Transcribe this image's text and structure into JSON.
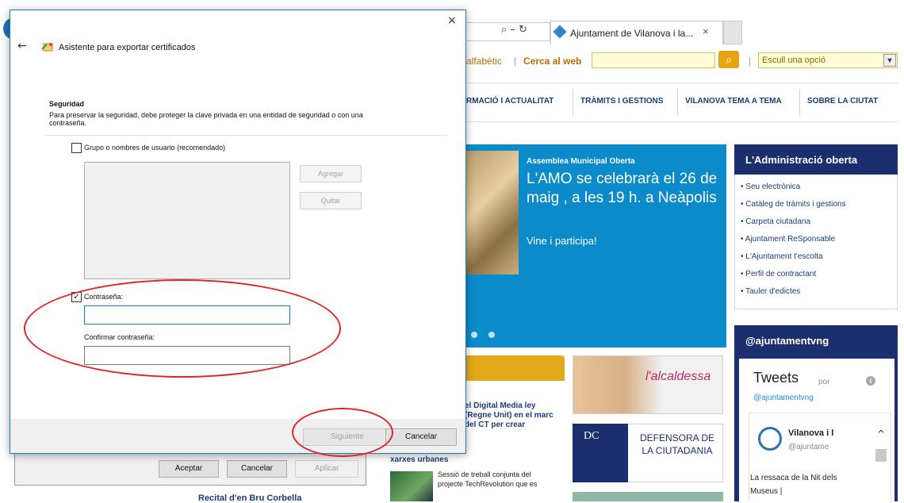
{
  "browser": {
    "tab_title": "Ajuntament de Vilanova i la...",
    "address_icons": "⌕ – ↻",
    "tab_close": "×",
    "toolbar": {
      "alfabetic": "alfabètic",
      "sep": "|",
      "cerca_web": "Cerca al web",
      "go": "⌕",
      "select_value": "Escull una opció",
      "select_arrow": "▼"
    },
    "nav": [
      "RMACIÓ I ACTUALITAT",
      "TRÀMITS I GESTIONS",
      "VILANOVA TEMA A TEMA",
      "SOBRE LA CIUTAT"
    ],
    "hero": {
      "kicker": "Assemblea Municipal Oberta",
      "title": "L'AMO se celebrarà el 26 de maig , a les 19 h. a Neàpolis",
      "link": "Vine i participa!"
    },
    "admin": {
      "title": "L'Administració oberta",
      "items": [
        "Seu electrònica",
        "Catàleg de tràmits i gestions",
        "Carpeta ciutadana",
        "Ajuntament ReSponsable",
        "L'Ajuntament t'escolta",
        "Perfil de contractant",
        "Tauler d'edictes"
      ],
      "bullet": "•"
    },
    "twitter": {
      "header": "@ajuntamentvng",
      "title": "Tweets",
      "por": "por",
      "info": "i",
      "handle": "@ajuntamentvng",
      "name": "Vilanova i l",
      "account": "@ajuntame",
      "text": "La ressaca de la Nit dels Museus |",
      "scroll_up": "^"
    },
    "news": {
      "text": "el Digital Media ley (Regne Unit) en el marc del CT per crear",
      "urbanes": "xarxes urbanes",
      "small": "Sessió de treball conjunta del projecte TechRevolution que es",
      "recital": "Recital d'en Bru Corbella"
    },
    "cards": {
      "alcaldessa": "l'alcaldessa",
      "dc": "DC",
      "defensora": "DEFENSORA DE LA CIUTADANIA"
    }
  },
  "props_dialog": {
    "accept": "Aceptar",
    "cancel": "Cancelar",
    "apply": "Aplicar"
  },
  "dialog": {
    "close": "×",
    "back": "←",
    "title": "Asistente para exportar certificados",
    "section_title": "Seguridad",
    "section_desc": "Para preservar la seguridad, debe proteger la clave privada en una entidad de seguridad o con una contraseña.",
    "group_checkbox_label": "Grupo o nombres de usuario (recomendado)",
    "group_checked": false,
    "add_button": "Agregar",
    "remove_button": "Quitar",
    "password_checkbox_label": "Contraseña:",
    "password_checked": true,
    "check_mark": "✓",
    "password_value": "",
    "confirm_label": "Confirmar contraseña:",
    "confirm_value": "",
    "next_button": "Siguiente",
    "cancel_button": "Cancelar"
  },
  "colors": {
    "annotation_red": "#e0262b",
    "dialog_border": "#1f7ac4",
    "hero_blue": "#0b8bc9",
    "navy": "#1b2f6e"
  }
}
